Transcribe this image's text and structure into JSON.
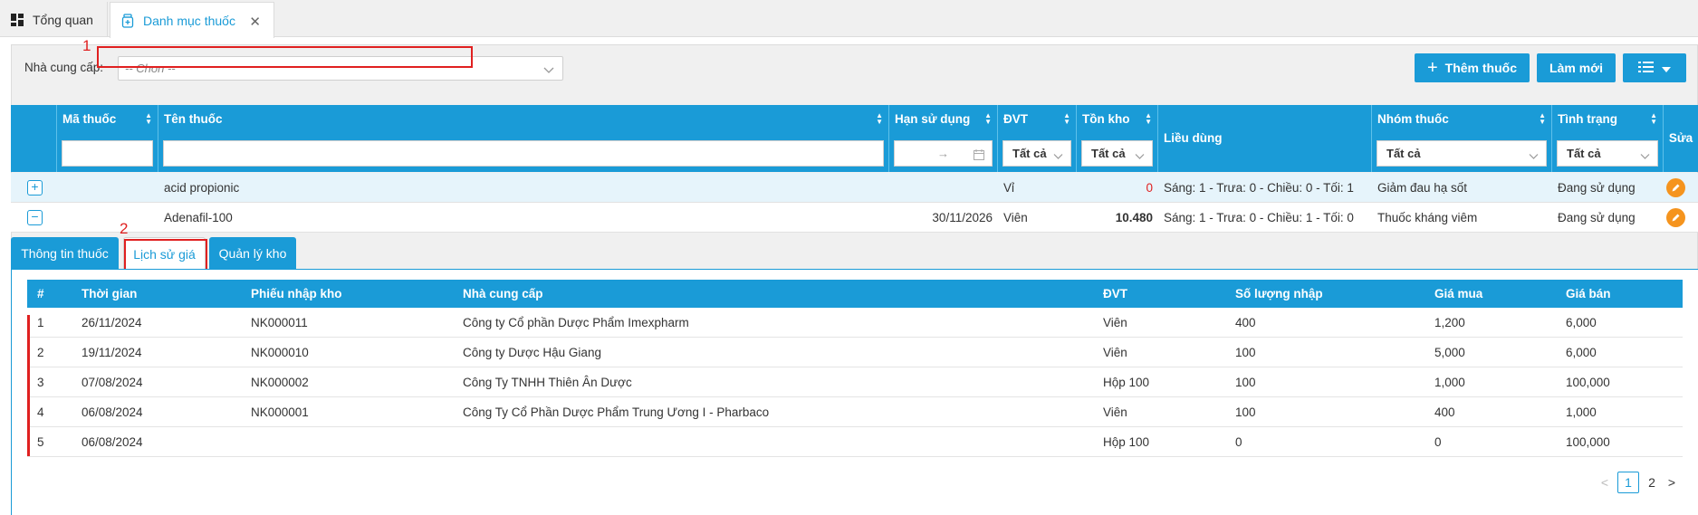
{
  "tabs": {
    "overview": "Tổng quan",
    "catalog": "Danh mục thuốc"
  },
  "filter": {
    "supplier_label": "Nhà cung cấp:",
    "supplier_placeholder": "-- Chon --",
    "marker1": "1",
    "marker2": "2"
  },
  "toolbar": {
    "add_label": "Thêm thuốc",
    "refresh_label": "Làm mới"
  },
  "grid": {
    "columns": {
      "code": "Mã thuốc",
      "name": "Tên thuốc",
      "expiry": "Hạn sử dụng",
      "unit": "ĐVT",
      "stock": "Tồn kho",
      "dosage": "Liều dùng",
      "group": "Nhóm thuốc",
      "status": "Tình trạng",
      "edit": "Sửa"
    },
    "filters": {
      "all": "Tất cả",
      "date_sep": "→"
    },
    "rows": [
      {
        "code": "",
        "name": "acid propionic",
        "expiry": "",
        "unit": "Vỉ",
        "stock": "0",
        "dosage": "Sáng: 1 - Trưa: 0 - Chiều: 0 - Tối: 1",
        "group": "Giảm đau hạ sốt",
        "status": "Đang sử dụng",
        "expand": "+"
      },
      {
        "code": "",
        "name": "Adenafil-100",
        "expiry": "30/11/2026",
        "unit": "Viên",
        "stock": "10.480",
        "dosage": "Sáng: 1 - Trưa: 0 - Chiều: 1 - Tối: 0",
        "group": "Thuốc kháng viêm",
        "status": "Đang sử dụng",
        "expand": "−"
      }
    ],
    "colors": {
      "accent": "#1a9bd7",
      "edit": "#f5941e",
      "danger": "#e02020"
    }
  },
  "detail_tabs": {
    "info": "Thông tin thuốc",
    "price_history": "Lịch sử giá",
    "stock_mgmt": "Quản lý kho"
  },
  "history": {
    "columns": {
      "idx": "#",
      "time": "Thời gian",
      "receipt": "Phiếu nhập kho",
      "supplier": "Nhà cung cấp",
      "unit": "ĐVT",
      "qty": "Số lượng nhập",
      "buy": "Giá mua",
      "sell": "Giá bán"
    },
    "rows": [
      {
        "idx": "1",
        "time": "26/11/2024",
        "receipt": "NK000011",
        "supplier": "Công ty Cổ phần Dược Phẩm Imexpharm",
        "unit": "Viên",
        "qty": "400",
        "buy": "1,200",
        "sell": "6,000"
      },
      {
        "idx": "2",
        "time": "19/11/2024",
        "receipt": "NK000010",
        "supplier": "Công ty Dược Hậu Giang",
        "unit": "Viên",
        "qty": "100",
        "buy": "5,000",
        "sell": "6,000"
      },
      {
        "idx": "3",
        "time": "07/08/2024",
        "receipt": "NK000002",
        "supplier": "Công Ty TNHH Thiên Ân Dược",
        "unit": "Hộp 100",
        "qty": "100",
        "buy": "1,000",
        "sell": "100,000"
      },
      {
        "idx": "4",
        "time": "06/08/2024",
        "receipt": "NK000001",
        "supplier": "Công Ty Cổ Phần Dược Phẩm Trung Ương I - Pharbaco",
        "unit": "Viên",
        "qty": "100",
        "buy": "400",
        "sell": "1,000"
      },
      {
        "idx": "5",
        "time": "06/08/2024",
        "receipt": "",
        "supplier": "",
        "unit": "Hộp 100",
        "qty": "0",
        "buy": "0",
        "sell": "100,000"
      }
    ]
  },
  "pager": {
    "prev": "<",
    "page1": "1",
    "page2": "2",
    "next": ">"
  }
}
